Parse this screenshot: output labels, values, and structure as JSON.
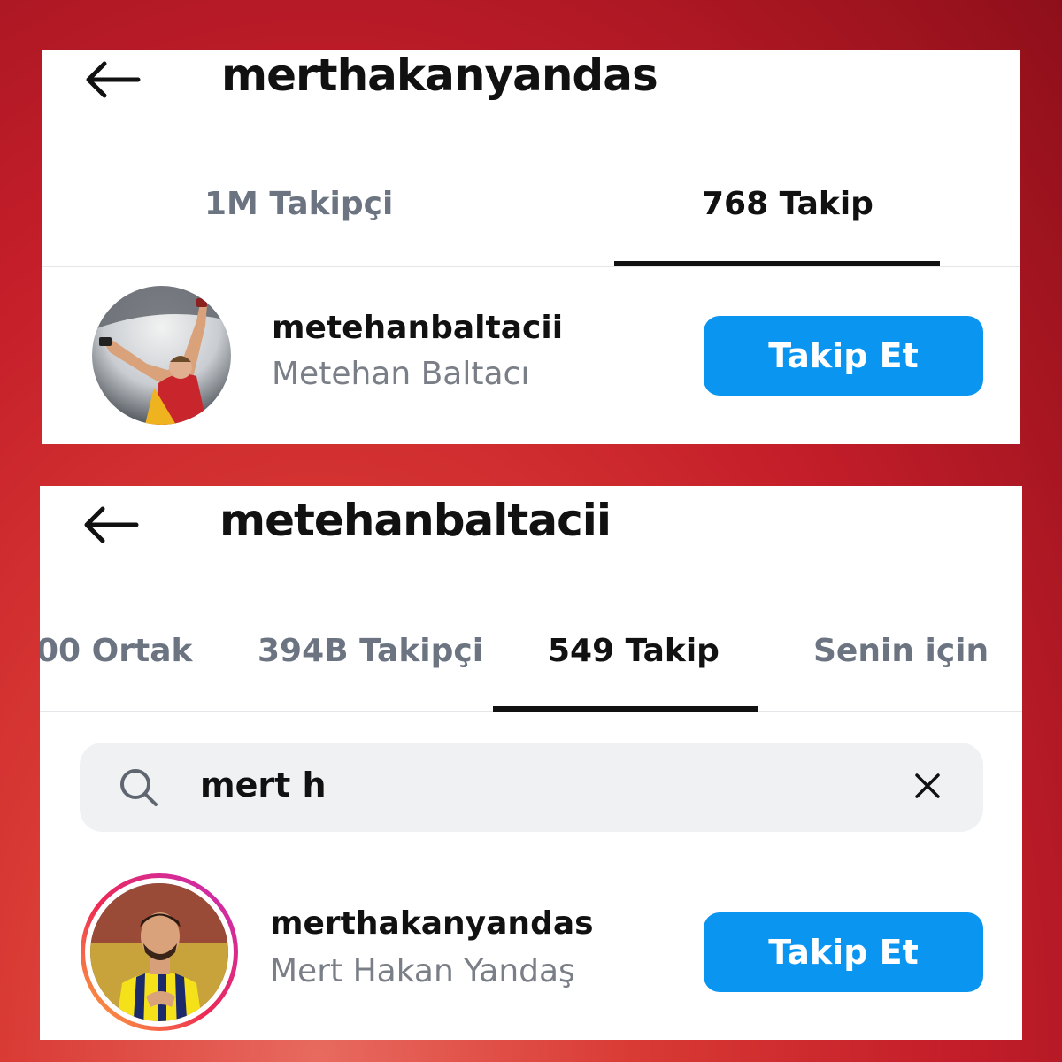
{
  "panel1": {
    "title": "merthakanyandas",
    "tabs": [
      {
        "label": "1M Takipçi",
        "active": false
      },
      {
        "label": "768 Takip",
        "active": true
      }
    ],
    "user": {
      "username": "metehanbaltacii",
      "fullname": "Metehan Baltacı",
      "button": "Takip Et"
    }
  },
  "panel2": {
    "title": "metehanbaltacii",
    "tabs": [
      {
        "label": "00 Ortak",
        "active": false
      },
      {
        "label": "394B Takipçi",
        "active": false
      },
      {
        "label": "549 Takip",
        "active": true
      },
      {
        "label": "Senin için",
        "active": false
      }
    ],
    "search": {
      "value": "mert h"
    },
    "user": {
      "username": "merthakanyandas",
      "fullname": "Mert Hakan Yandaş",
      "button": "Takip Et"
    }
  },
  "colors": {
    "accent": "#0a96f0",
    "background_red": "#c41e2a",
    "tab_inactive": "#6b7480"
  },
  "icons": [
    "arrow-left-icon",
    "search-icon",
    "close-icon"
  ]
}
